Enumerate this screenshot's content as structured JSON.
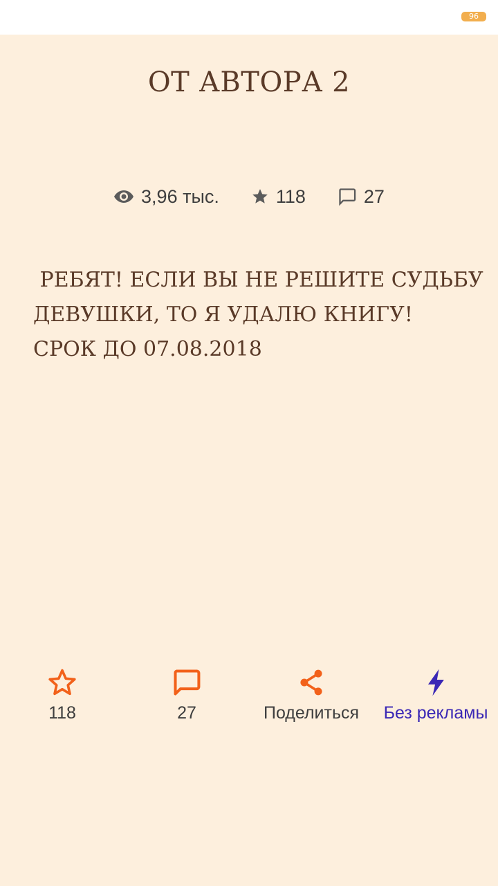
{
  "status_bar": {
    "battery_level": "96"
  },
  "chapter": {
    "title": "ОТ АВТОРА 2"
  },
  "stats": {
    "views": "3,96 тыс.",
    "stars": "118",
    "comments": "27"
  },
  "body": {
    "lines": [
      " РЕБЯТ! ЕСЛИ ВЫ НЕ РЕШИТЕ СУДЬБУ",
      "ДЕВУШКИ, ТО Я УДАЛЮ КНИГУ!",
      "СРОК ДО 07.08.2018"
    ]
  },
  "actions": {
    "like_count": "118",
    "comment_count": "27",
    "share_label": "Поделиться",
    "noads_label": "Без рекламы"
  },
  "icons": {
    "views": "eye-icon",
    "stars": "star-icon",
    "comments": "comment-icon",
    "like": "star-outline-icon",
    "comment": "chat-bubble-icon",
    "share": "share-icon",
    "noads": "lightning-icon"
  },
  "colors": {
    "background": "#FDEFDD",
    "text_primary": "#5A3A28",
    "accent_orange": "#F2611A",
    "accent_purple": "#3A27B5",
    "battery": "#F2AE4E"
  }
}
